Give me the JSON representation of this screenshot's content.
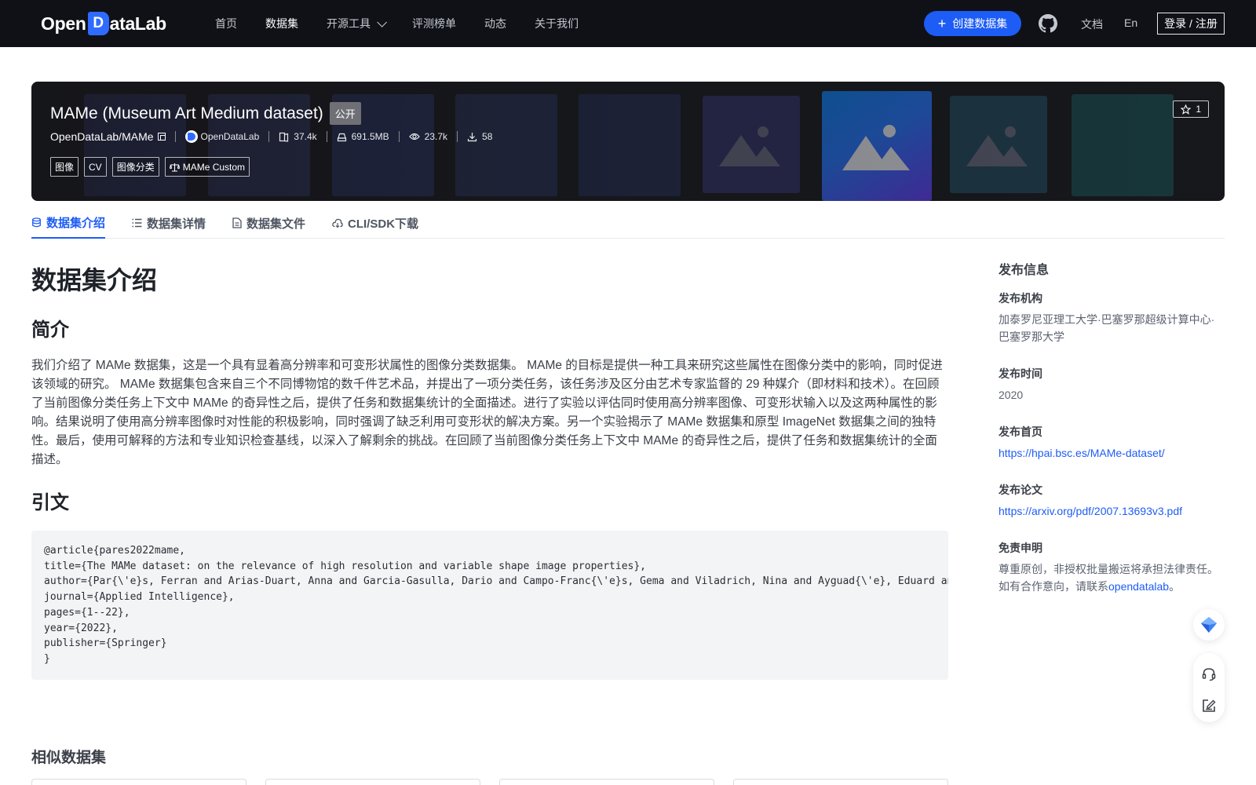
{
  "nav": {
    "logo_prefix": "Open",
    "logo_mark": "D",
    "logo_suffix": "ataLab",
    "links": [
      "首页",
      "数据集",
      "开源工具",
      "评测榜单",
      "动态",
      "关于我们"
    ],
    "active_link": "数据集",
    "create_label": "创建数据集",
    "doc_label": "文档",
    "lang_label": "En",
    "login_label": "登录 / 注册",
    "accent": "#1d5cf5"
  },
  "dataset": {
    "title": "MAMe (Museum Art Medium dataset)",
    "visibility": "公开",
    "repo": "OpenDataLab/MAMe",
    "org": "OpenDataLab",
    "files": "37.4k",
    "size": "691.5MB",
    "views": "23.7k",
    "downloads": "58",
    "tags": [
      "图像",
      "CV",
      "图像分类"
    ],
    "license": "MAMe Custom",
    "stars": "1"
  },
  "tabs": [
    "数据集介绍",
    "数据集详情",
    "数据集文件",
    "CLI/SDK下载"
  ],
  "content": {
    "heading": "数据集介绍",
    "intro_heading": "简介",
    "intro": "我们介绍了 MAMe 数据集，这是一个具有显着高分辨率和可变形状属性的图像分类数据集。 MAMe 的目标是提供一种工具来研究这些属性在图像分类中的影响，同时促进该领域的研究。 MAMe 数据集包含来自三个不同博物馆的数千件艺术品，并提出了一项分类任务，该任务涉及区分由艺术专家监督的 29 种媒介（即材料和技术）。在回顾了当前图像分类任务上下文中 MAMe 的奇异性之后，提供了任务和数据集统计的全面描述。进行了实验以评估同时使用高分辨率图像、可变形状输入以及这两种属性的影响。结果说明了使用高分辨率图像时对性能的积极影响，同时强调了缺乏利用可变形状的解决方案。另一个实验揭示了 MAMe 数据集和原型 ImageNet 数据集之间的独特性。最后，使用可解释的方法和专业知识检查基线，以深入了解剩余的挑战。在回顾了当前图像分类任务上下文中 MAMe 的奇异性之后，提供了任务和数据集统计的全面描述。",
    "citation_heading": "引文",
    "citation": "@article{pares2022mame,\ntitle={The MAMe dataset: on the relevance of high resolution and variable shape image properties},\nauthor={Par{\\'e}s, Ferran and Arias-Duart, Anna and Garcia-Gasulla, Dario and Campo-Franc{\\'e}s, Gema and Viladrich, Nina and Ayguad{\\'e}, Eduard and Labarta, Jes{\\'u}s},\njournal={Applied Intelligence},\npages={1--22},\nyear={2022},\npublisher={Springer}\n}",
    "similar_heading": "相似数据集"
  },
  "sidebar": {
    "title": "发布信息",
    "org_label": "发布机构",
    "org_value": "加泰罗尼亚理工大学·巴塞罗那超级计算中心·巴塞罗那大学",
    "time_label": "发布时间",
    "time_value": "2020",
    "home_label": "发布首页",
    "home_url": "https://hpai.bsc.es/MAMe-dataset/",
    "paper_label": "发布论文",
    "paper_url": "https://arxiv.org/pdf/2007.13693v3.pdf",
    "disclaimer_label": "免责申明",
    "disclaimer_line1": "尊重原创，非授权批量搬运将承担法律责任。",
    "disclaimer_line2_prefix": "如有合作意向，请联系",
    "disclaimer_contact": "opendatalab",
    "disclaimer_line2_suffix": "。"
  },
  "icons": {
    "github": "github-icon",
    "star": "star-icon",
    "files": "files-icon",
    "size": "disk-icon",
    "views": "eye-icon",
    "downloads": "download-icon",
    "license": "scale-icon"
  }
}
